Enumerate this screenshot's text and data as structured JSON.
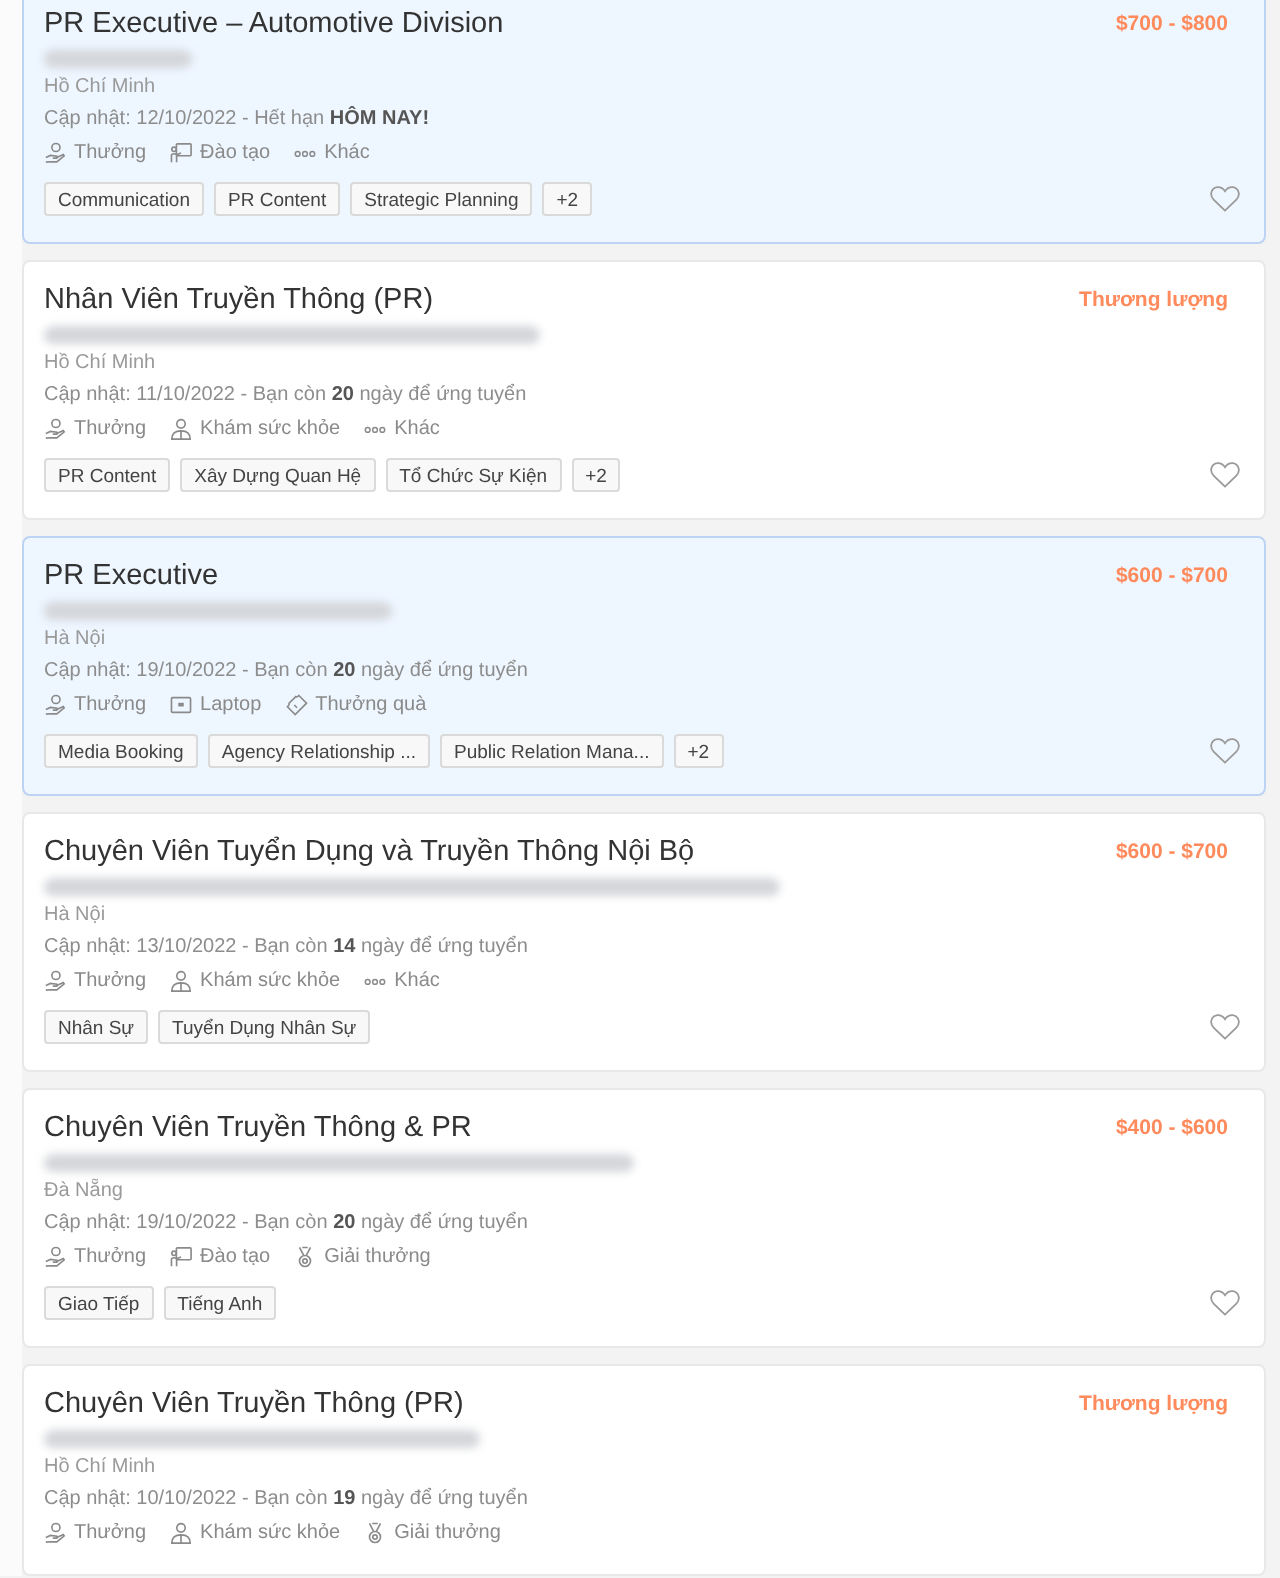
{
  "jobs": [
    {
      "title": "PR Executive – Automotive Division",
      "salary": "$700 - $800",
      "highlighted": true,
      "location": "Hồ Chí Minh",
      "update": "Cập nhật: 12/10/2022 - Hết hạn **HÔM NAY!**",
      "benefits": [
        {
          "kind": "bonus",
          "label": "Thưởng"
        },
        {
          "kind": "training",
          "label": "Đào tạo"
        },
        {
          "kind": "other",
          "label": "Khác"
        }
      ],
      "tags": [
        "Communication",
        "PR Content",
        "Strategic Planning"
      ],
      "more_tags": "+2",
      "saved": false
    },
    {
      "title": "Nhân Viên Truyền Thông (PR)",
      "salary": "Thương lượng",
      "highlighted": false,
      "location": "Hồ Chí Minh",
      "update": "Cập nhật: 11/10/2022 - Bạn còn **20** ngày để ứng tuyển",
      "benefits": [
        {
          "kind": "bonus",
          "label": "Thưởng"
        },
        {
          "kind": "health",
          "label": "Khám sức khỏe"
        },
        {
          "kind": "other",
          "label": "Khác"
        }
      ],
      "tags": [
        "PR Content",
        "Xây Dựng Quan Hệ",
        "Tổ Chức Sự Kiện"
      ],
      "more_tags": "+2",
      "saved": false
    },
    {
      "title": "PR Executive",
      "salary": "$600 - $700",
      "highlighted": true,
      "location": "Hà Nội",
      "update": "Cập nhật: 19/10/2022 - Bạn còn **20** ngày để ứng tuyển",
      "benefits": [
        {
          "kind": "bonus",
          "label": "Thưởng"
        },
        {
          "kind": "laptop",
          "label": "Laptop"
        },
        {
          "kind": "gift",
          "label": "Thưởng quà"
        }
      ],
      "tags": [
        "Media Booking",
        "Agency Relationship ...",
        "Public Relation Mana..."
      ],
      "more_tags": "+2",
      "saved": false
    },
    {
      "title": "Chuyên Viên Tuyển Dụng và Truyền Thông Nội Bộ",
      "salary": "$600 - $700",
      "highlighted": false,
      "location": "Hà Nội",
      "update": "Cập nhật: 13/10/2022 - Bạn còn **14** ngày để ứng tuyển",
      "benefits": [
        {
          "kind": "bonus",
          "label": "Thưởng"
        },
        {
          "kind": "health",
          "label": "Khám sức khỏe"
        },
        {
          "kind": "other",
          "label": "Khác"
        }
      ],
      "tags": [
        "Nhân Sự",
        "Tuyển Dụng Nhân Sự"
      ],
      "saved": false
    },
    {
      "title": "Chuyên Viên Truyền Thông & PR",
      "salary": "$400 - $600",
      "highlighted": false,
      "location": "Đà Nẵng",
      "update": "Cập nhật: 19/10/2022 - Bạn còn **20** ngày để ứng tuyển",
      "benefits": [
        {
          "kind": "bonus",
          "label": "Thưởng"
        },
        {
          "kind": "training",
          "label": "Đào tạo"
        },
        {
          "kind": "award",
          "label": "Giải thưởng"
        }
      ],
      "tags": [
        "Giao Tiếp",
        "Tiếng Anh"
      ],
      "saved": false
    },
    {
      "title": "Chuyên Viên Truyền Thông (PR)",
      "salary": "Thương lượng",
      "highlighted": false,
      "location": "Hồ Chí Minh",
      "update": "Cập nhật: 10/10/2022 - Bạn còn **19** ngày để ứng tuyển",
      "benefits": [
        {
          "kind": "bonus",
          "label": "Thưởng"
        },
        {
          "kind": "health",
          "label": "Khám sức khỏe"
        },
        {
          "kind": "award",
          "label": "Giải thưởng"
        }
      ]
    }
  ]
}
